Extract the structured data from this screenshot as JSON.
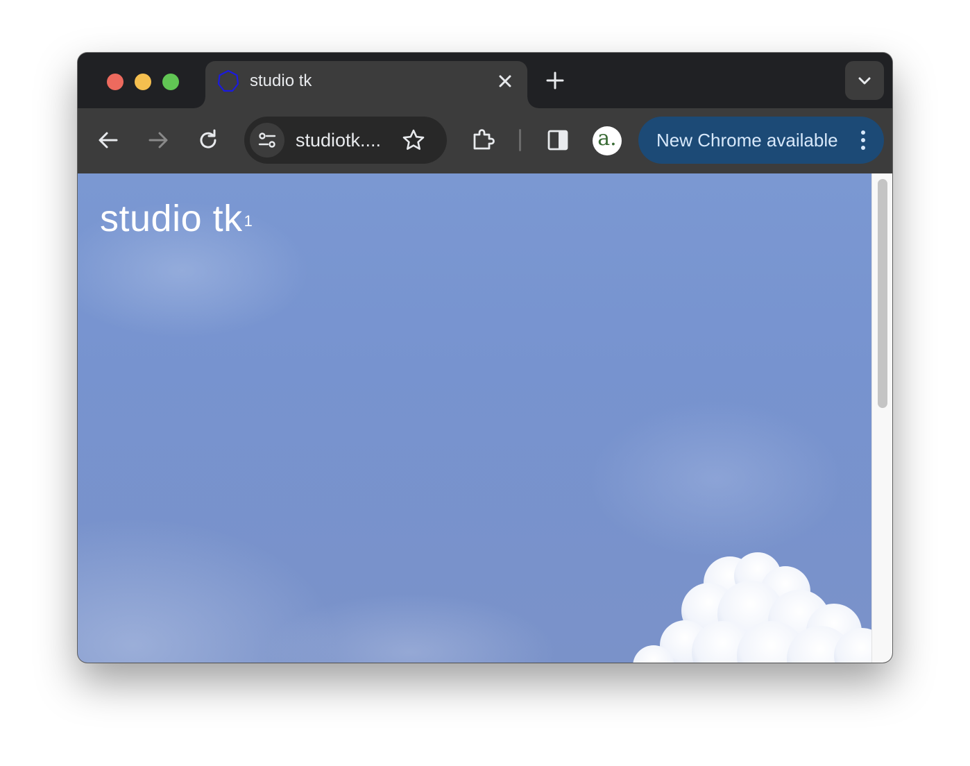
{
  "tab": {
    "title": "studio tk"
  },
  "toolbar": {
    "url": "studiotk....",
    "update_label": "New Chrome available",
    "profile_letter": "a."
  },
  "page": {
    "title": "studio tk",
    "title_sup": "1"
  },
  "colors": {
    "favicon": "#1a1adf",
    "update_pill": "#1c4a76",
    "sky": "#7793cf"
  },
  "icons": {
    "favicon": "hexagon-outline",
    "back": "arrow-left",
    "forward": "arrow-right",
    "reload": "reload",
    "site_info": "tune-sliders",
    "bookmark": "star-outline",
    "extensions": "puzzle-piece",
    "side_panel": "side-panel",
    "menu": "three-dots-vertical"
  }
}
